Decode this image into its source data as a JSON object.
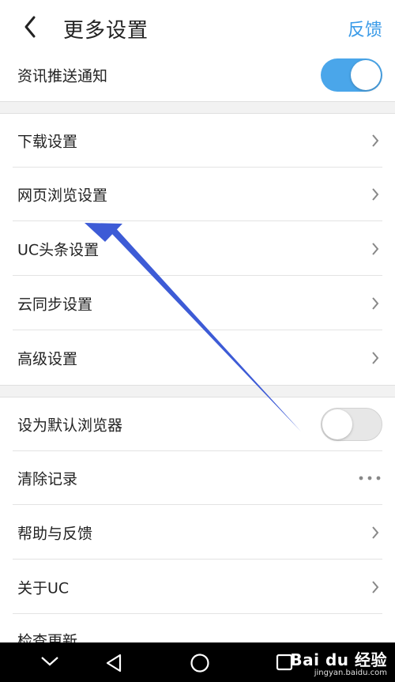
{
  "header": {
    "title": "更多设置",
    "feedback_label": "反馈"
  },
  "rows": {
    "news_push": {
      "label": "资讯推送通知",
      "toggle_on": true
    },
    "download": {
      "label": "下载设置"
    },
    "web_browse": {
      "label": "网页浏览设置"
    },
    "uc_headlines": {
      "label": "UC头条设置"
    },
    "cloud_sync": {
      "label": "云同步设置"
    },
    "advanced": {
      "label": "高级设置"
    },
    "default_browser": {
      "label": "设为默认浏览器",
      "toggle_on": false
    },
    "clear_records": {
      "label": "清除记录"
    },
    "help_feedback": {
      "label": "帮助与反馈"
    },
    "about_uc": {
      "label": "关于UC"
    },
    "check_update": {
      "label": "检查更新"
    }
  },
  "watermark": {
    "main": "Bai du 经验",
    "sub": "jingyan.baidu.com"
  },
  "colors": {
    "accent": "#3a9be8",
    "toggle_on": "#4aa6ea",
    "arrow": "#3d5bd6"
  }
}
